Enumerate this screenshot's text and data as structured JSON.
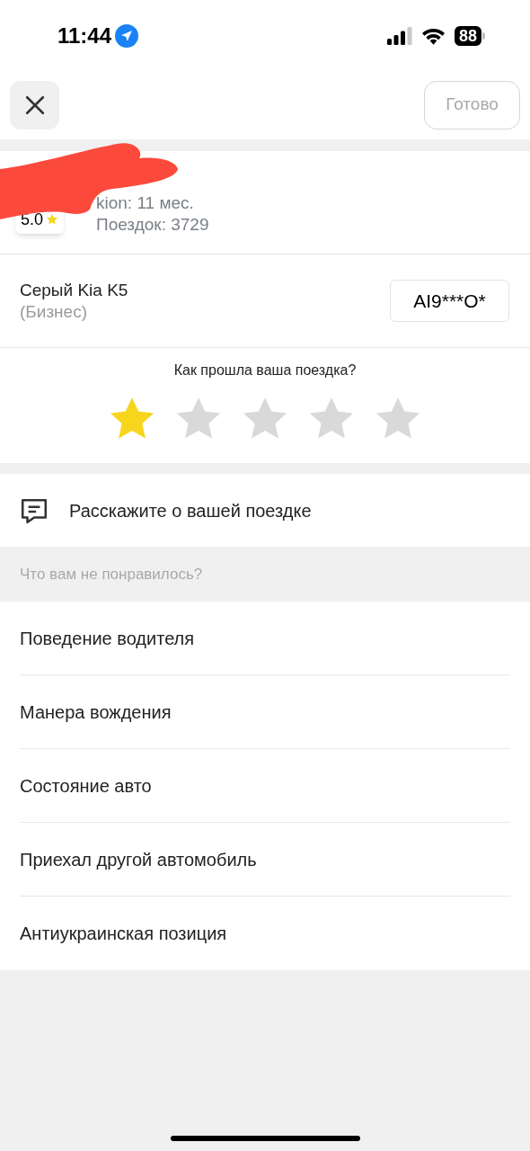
{
  "status_bar": {
    "time": "11:44",
    "battery": "88"
  },
  "header": {
    "done_button": "Готово",
    "done_disabled": true
  },
  "driver": {
    "rating": "5.0",
    "experience": "kion: 11 мес.",
    "trips": "Поездок: 3729"
  },
  "car": {
    "name": "Серый Kia K5",
    "class": "(Бизнес)",
    "plate": "AI9***O*"
  },
  "rating": {
    "question": "Как прошла ваша поездка?",
    "stars": 1
  },
  "comment": {
    "label": "Расскажите о вашей поездке"
  },
  "complaints": {
    "heading": "Что вам не понравилось?",
    "items": [
      {
        "label": "Поведение водителя"
      },
      {
        "label": "Манера вождения"
      },
      {
        "label": "Состояние авто"
      },
      {
        "label": "Приехал другой автомобиль"
      },
      {
        "label": "Антиукраинская позиция"
      }
    ]
  }
}
